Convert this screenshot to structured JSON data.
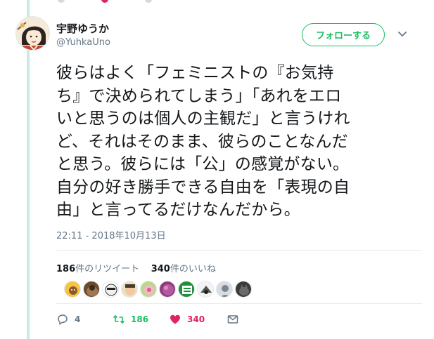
{
  "user": {
    "display_name": "宇野ゆうか",
    "handle": "@YuhkaUno"
  },
  "follow_button": {
    "label": "フォロー​する"
  },
  "tweet": {
    "lines": [
      "彼らはよく「フェミニストの『お気持",
      "ち』で決められてしまう」「あれをエロ",
      "いと思うのは個人の主観だ」と言うけれ",
      "ど、それはそのまま、彼らのことなんだ",
      "と思う。彼らには「公」の感覚がない。",
      "自分の好き勝手できる自由を「表現の自",
      "由」と言ってるだけなんだから。"
    ],
    "timestamp": "22:11 - 2018年10月13日"
  },
  "stats": {
    "retweet_count": "186",
    "retweet_label": "件のリツイート",
    "like_count": "340",
    "like_label": "件のいいね"
  },
  "actions": {
    "reply_count": "4",
    "retweet_count": "186",
    "like_count": "340"
  },
  "colors": {
    "accent_green": "#17bf63",
    "like_red": "#e0245e",
    "muted": "#657786",
    "thread_line": "#c8ebe3"
  }
}
